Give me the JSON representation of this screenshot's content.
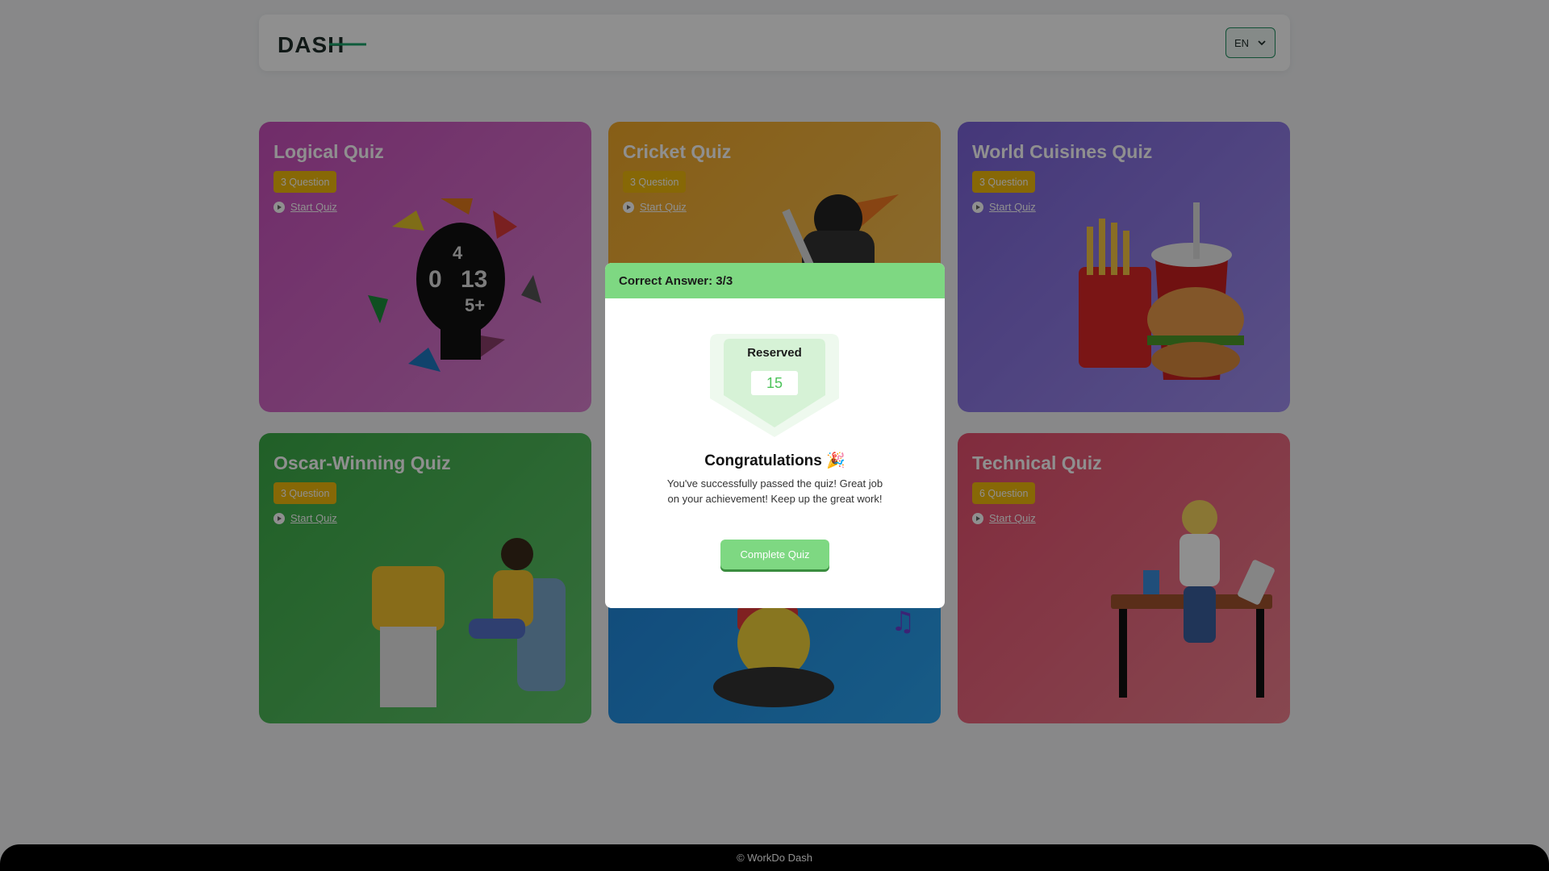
{
  "header": {
    "logo_text": "DASH",
    "language": "EN"
  },
  "cards": [
    {
      "title": "Logical Quiz",
      "badge": "3 Question",
      "action": "Start Quiz",
      "icon": "brain-head-illustration"
    },
    {
      "title": "Cricket Quiz",
      "badge": "3 Question",
      "action": "Start Quiz",
      "icon": "cricket-batsman-illustration"
    },
    {
      "title": "World Cuisines Quiz",
      "badge": "3 Question",
      "action": "Start Quiz",
      "icon": "burger-fries-illustration"
    },
    {
      "title": "Oscar-Winning Quiz",
      "badge": "3 Question",
      "action": "Start Quiz",
      "icon": "movie-watcher-illustration"
    },
    {
      "title": "",
      "badge": "",
      "action": "",
      "icon": "music-listener-illustration"
    },
    {
      "title": "Technical Quiz",
      "badge": "6 Question",
      "action": "Start Quiz",
      "icon": "developer-desk-illustration"
    }
  ],
  "modal": {
    "header": "Correct Answer: 3/3",
    "shield_label": "Reserved",
    "score": "15",
    "title": "Congratulations 🎉",
    "message": "You've successfully passed the quiz! Great job on your achievement! Keep up the great work!",
    "button": "Complete Quiz"
  },
  "footer": {
    "text": "© WorkDo Dash"
  },
  "colors": {
    "accent_green": "#7ed882",
    "badge_yellow": "#f0b90b",
    "brand_dark": "#1f2d2a"
  }
}
